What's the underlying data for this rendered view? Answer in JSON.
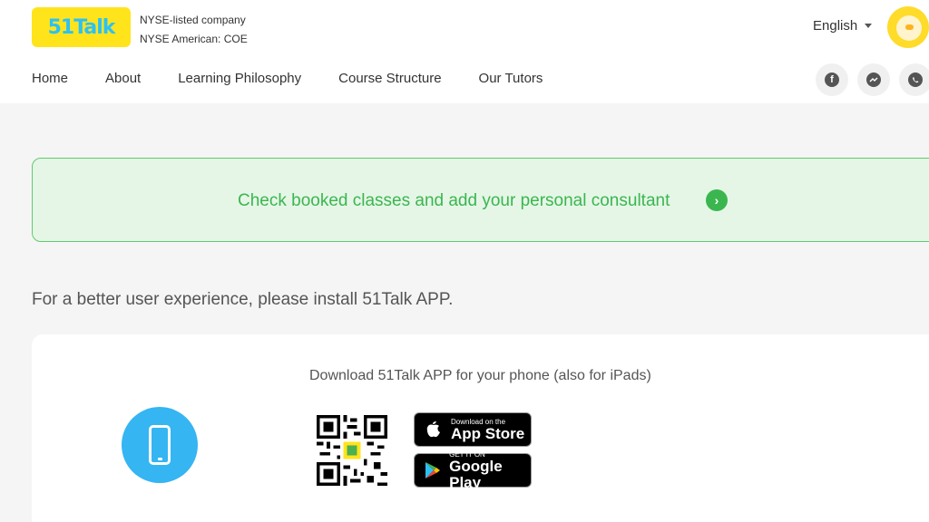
{
  "header": {
    "logo_text": "51Talk",
    "company_line1": "NYSE-listed company",
    "company_line2": "NYSE American: COE",
    "language": "English"
  },
  "nav": {
    "items": [
      "Home",
      "About",
      "Learning Philosophy",
      "Course Structure",
      "Our Tutors"
    ]
  },
  "social": {
    "icons": [
      "facebook-icon",
      "messenger-icon",
      "whatsapp-icon"
    ]
  },
  "banner": {
    "text": "Check booked classes and add your personal consultant",
    "arrow": "›"
  },
  "install": {
    "text": "For a better user experience, please install 51Talk APP."
  },
  "download_card": {
    "title": "Download 51Talk APP for your phone (also for iPads)",
    "app_store": {
      "small": "Download on the",
      "big": "App Store"
    },
    "google_play": {
      "small": "GET IT ON",
      "big": "Google Play"
    }
  },
  "colors": {
    "brand_yellow": "#ffe41c",
    "brand_blue": "#2cc1f5",
    "success_green": "#3bb64f",
    "phone_blue": "#35b5f2"
  }
}
